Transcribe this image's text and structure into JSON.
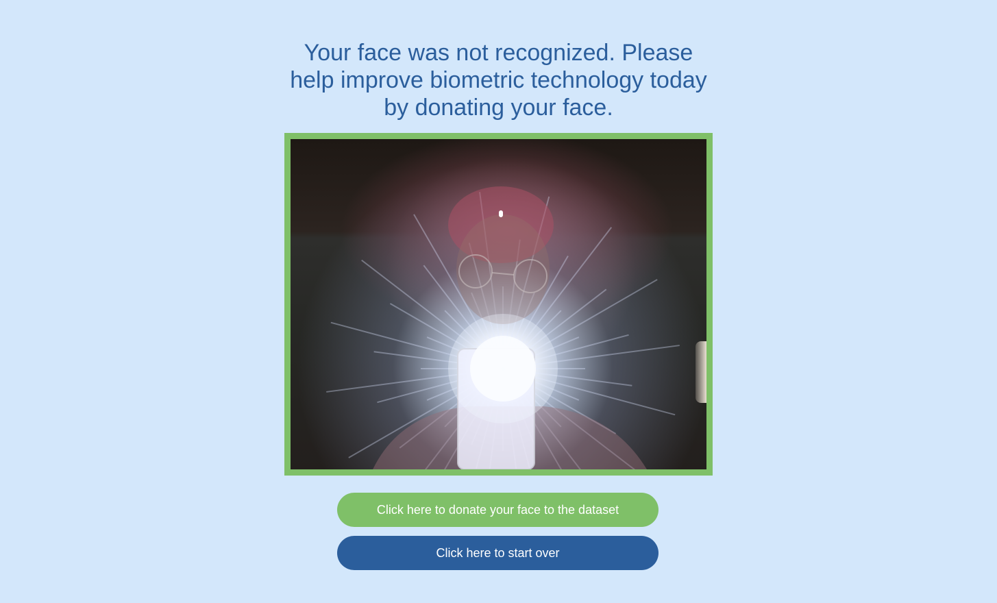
{
  "message": {
    "text": "Your face was not recognized. Please help improve biometric technology today by donating your face."
  },
  "camera": {
    "description_icon": "webcam-capture"
  },
  "buttons": {
    "donate_label": "Click here to donate your face to the dataset",
    "restart_label": "Click here to start over"
  },
  "colors": {
    "background": "#d3e7fb",
    "accent_green": "#7fc068",
    "accent_blue": "#2b5e9c",
    "text": "#2b5e9c"
  }
}
